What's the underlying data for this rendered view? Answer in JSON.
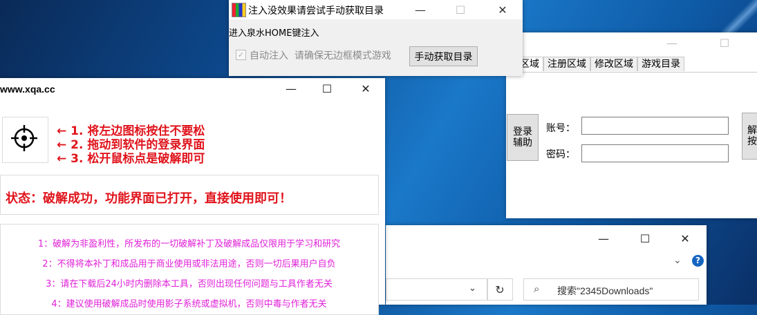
{
  "injector": {
    "title": "注入没效果请尝试手动获取目录",
    "line1": "进入泉水HOME键注入",
    "auto_inject_label": "自动注入",
    "hint": "请确保无边框模式游戏",
    "get_dir_button": "手动获取目录",
    "min_icon": "—",
    "max_icon": "☐",
    "close_icon": "✕",
    "auto_inject_checked": true
  },
  "account": {
    "tabs": [
      "录区域",
      "注册区域",
      "修改区域",
      "游戏目录"
    ],
    "login_assist": "登录\n辅助",
    "account_label": "账号：",
    "password_label": "密码：",
    "right_button_partial": "解\n按",
    "account_value": "",
    "password_value": "",
    "min_icon": "—",
    "max_icon": "☐"
  },
  "cracker": {
    "title": "www.xqa.cc",
    "min_icon": "—",
    "max_icon": "☐",
    "close_icon": "✕",
    "steps": [
      "← 1. 将左边图标按住不要松",
      "← 2. 拖动到软件的登录界面",
      "← 3. 松开鼠标点是破解即可"
    ],
    "status": "状态：破解成功，功能界面已打开，直接使用即可！",
    "notices": [
      "1：破解为非盈利性，所发布的一切破解补丁及破解成品仅限用于学习和研究",
      "2：不得将本补丁和成品用于商业使用或非法用途，否则一切后果用户自负",
      "3：请在下载后24小时内删除本工具，否则出现任何问题与工具作者无关",
      "4：建议使用破解成品时使用影子系统或虚拟机，否则中毒与作者无关"
    ],
    "colors": {
      "red": "#e0131b",
      "magenta": "#e020d8"
    }
  },
  "explorer": {
    "min_icon": "—",
    "max_icon": "☐",
    "close_icon": "✕",
    "chevron": "⌄",
    "help": "?",
    "dropdown": "⌄",
    "refresh": "↻",
    "search_icon": "⌕",
    "search_placeholder": "搜索\"2345Downloads\""
  }
}
